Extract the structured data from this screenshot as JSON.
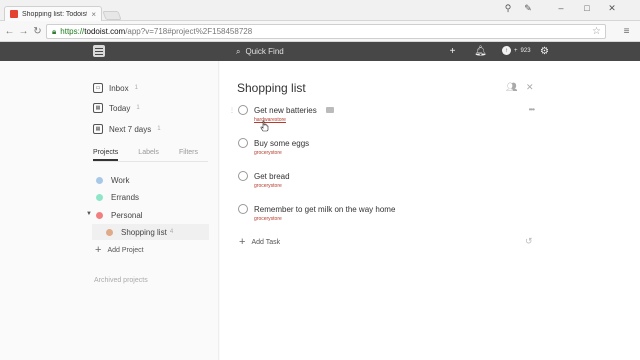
{
  "browser": {
    "tab_title": "Shopping list: Todoist",
    "url_scheme": "https://",
    "url_host": "todoist.com",
    "url_path": "/app?v=718#project%2F158458728"
  },
  "header": {
    "quick_find": "Quick Find",
    "karma": "923"
  },
  "sidebar": {
    "filters": [
      {
        "label": "Inbox",
        "count": "1",
        "icon": "inbox-icon"
      },
      {
        "label": "Today",
        "count": "1",
        "icon": "calendar-icon"
      },
      {
        "label": "Next 7 days",
        "count": "1",
        "icon": "calendar-week-icon"
      }
    ],
    "tabs": [
      "Projects",
      "Labels",
      "Filters"
    ],
    "projects": [
      {
        "label": "Work",
        "color": "#a8c8e8"
      },
      {
        "label": "Errands",
        "color": "#8ee6c9"
      },
      {
        "label": "Personal",
        "color": "#f08080"
      },
      {
        "label": "Shopping list",
        "count": "4",
        "color": "#e0a987"
      }
    ],
    "add_project": "Add Project",
    "archived": "Archived projects"
  },
  "main": {
    "title": "Shopping list",
    "tasks": [
      {
        "text": "Get new batteries",
        "label": "hardwarestore"
      },
      {
        "text": "Buy some eggs",
        "label": "grocerystore"
      },
      {
        "text": "Get bread",
        "label": "grocerystore"
      },
      {
        "text": "Remember to get milk on the way home",
        "label": "grocerystore"
      }
    ],
    "add_task": "Add Task"
  },
  "colors": {
    "header_bg": "#474747",
    "label": "#b53b2c",
    "brand": "#e44332"
  }
}
